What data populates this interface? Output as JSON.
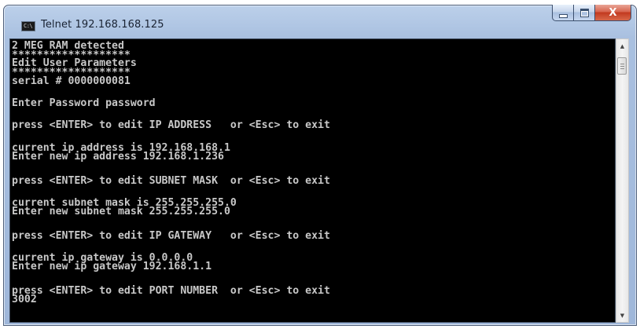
{
  "window": {
    "title": "Telnet 192.168.168.125",
    "icon_label": "C:\\"
  },
  "controls": {
    "minimize": "minimize-icon",
    "maximize": "maximize-icon",
    "close_glyph": "X"
  },
  "console": {
    "lines": [
      "2 MEG RAM detected",
      "*******************",
      "Edit User Parameters",
      "*******************",
      "serial # 0000000081",
      "Enter Password password",
      "press <ENTER> to edit IP ADDRESS   or <Esc> to exit",
      "current ip address is 192.168.168.1",
      "Enter new ip address 192.168.1.236",
      "press <ENTER> to edit SUBNET MASK  or <Esc> to exit",
      "current subnet mask is 255.255.255.0",
      "Enter new subnet mask 255.255.255.0",
      "press <ENTER> to edit IP GATEWAY   or <Esc> to exit",
      "current ip gateway is 0.0.0.0",
      "Enter new ip gateway 192.168.1.1",
      "press <ENTER> to edit PORT NUMBER  or <Esc> to exit",
      "3002"
    ],
    "text_color": "#c8c8c8",
    "background": "#000000"
  },
  "scrollbar": {
    "up_icon": "scroll-up-arrow-icon",
    "down_icon": "scroll-down-arrow-icon"
  }
}
